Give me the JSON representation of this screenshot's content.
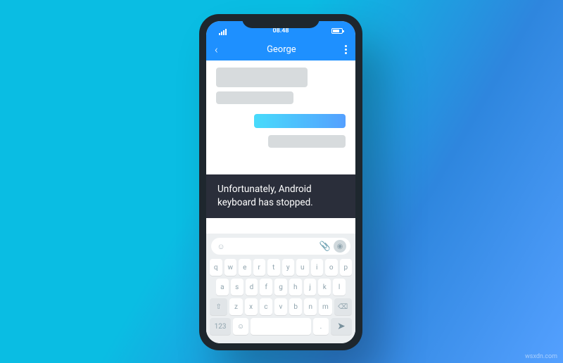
{
  "statusbar": {
    "time": "08.48"
  },
  "navbar": {
    "title": "George"
  },
  "toast": {
    "line1": "Unfortunately, Android",
    "line2": "keyboard has stopped."
  },
  "keyboard": {
    "input_placeholder": "",
    "rows": {
      "r1": [
        "q",
        "w",
        "e",
        "r",
        "t",
        "y",
        "u",
        "i",
        "o",
        "p"
      ],
      "r2": [
        "a",
        "s",
        "d",
        "f",
        "g",
        "h",
        "j",
        "k",
        "l"
      ],
      "r3": [
        "⇧",
        "z",
        "x",
        "c",
        "v",
        "b",
        "n",
        "m",
        "⌫"
      ],
      "r4_123": "123",
      "r4_emoji": "☺",
      "r4_space": "",
      "r4_dot": ".",
      "r4_send": "➤"
    }
  },
  "watermark": "wsxdn.com"
}
